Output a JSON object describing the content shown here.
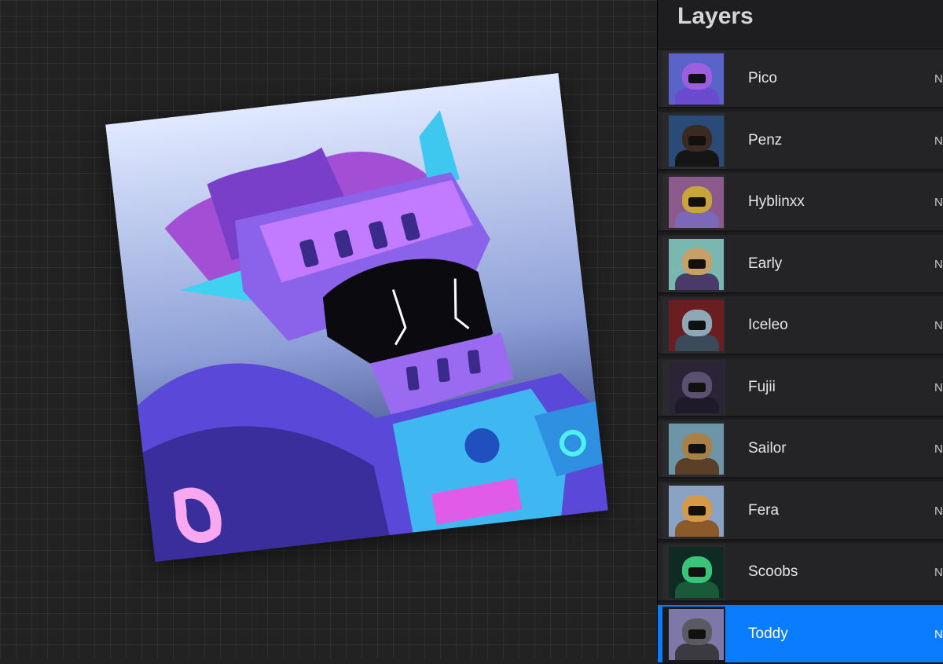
{
  "panel": {
    "title": "Layers",
    "layers": [
      {
        "name": "Pico",
        "blend": "N",
        "selected": false,
        "thumb": {
          "bg": "#5a63c8",
          "head": "#9b5fe0",
          "body": "#6a4bd0",
          "icon": "armored-knight-thumbnail"
        }
      },
      {
        "name": "Penz",
        "blend": "N",
        "selected": false,
        "thumb": {
          "bg": "#2a4a78",
          "head": "#3b2a22",
          "body": "#151515",
          "icon": "hooded-bear-thumbnail"
        }
      },
      {
        "name": "Hyblinxx",
        "blend": "N",
        "selected": false,
        "thumb": {
          "bg": "#8a5a8c",
          "head": "#c9a43a",
          "body": "#7c68b8",
          "icon": "gold-mask-bear-thumbnail"
        }
      },
      {
        "name": "Early",
        "blend": "N",
        "selected": false,
        "thumb": {
          "bg": "#7ab7b0",
          "head": "#c7a068",
          "body": "#4a3a6a",
          "icon": "explorer-bear-thumbnail"
        }
      },
      {
        "name": "Iceleo",
        "blend": "N",
        "selected": false,
        "thumb": {
          "bg": "#6a1e22",
          "head": "#8fa8b8",
          "body": "#3a4a5a",
          "icon": "ice-lion-thumbnail"
        }
      },
      {
        "name": "Fujii",
        "blend": "N",
        "selected": false,
        "thumb": {
          "bg": "#2a2436",
          "head": "#5a5070",
          "body": "#1e1a2a",
          "icon": "dark-bear-thumbnail"
        }
      },
      {
        "name": "Sailor",
        "blend": "N",
        "selected": false,
        "thumb": {
          "bg": "#6e94a8",
          "head": "#a88048",
          "body": "#5a4028",
          "icon": "sailor-bear-thumbnail"
        }
      },
      {
        "name": "Fera",
        "blend": "N",
        "selected": false,
        "thumb": {
          "bg": "#8aa2c4",
          "head": "#d49a48",
          "body": "#8a5a28",
          "icon": "crowned-bear-thumbnail"
        }
      },
      {
        "name": "Scoobs",
        "blend": "N",
        "selected": false,
        "thumb": {
          "bg": "#0e2a22",
          "head": "#3ac47a",
          "body": "#1a5a3a",
          "icon": "skeleton-bear-thumbnail"
        }
      },
      {
        "name": "Toddy",
        "blend": "N",
        "selected": true,
        "thumb": {
          "bg": "#7e78a8",
          "head": "#5a5a60",
          "body": "#3a3a40",
          "icon": "armored-bear-thumbnail"
        }
      }
    ]
  },
  "canvas": {
    "artwork": "armored-knight-artwork",
    "colors": {
      "sky_top": "#dfe8ff",
      "sky_bottom": "#1e2a6a",
      "armor_violet": "#7b5ce8",
      "armor_pink": "#c77dff",
      "armor_blue": "#3fb8f2",
      "hair_purple": "#9b4fd6",
      "visor_black": "#0b0b0f"
    }
  },
  "colors": {
    "accent": "#0a7cff",
    "panel_bg": "#1c1c1e",
    "canvas_bg": "#222222"
  }
}
